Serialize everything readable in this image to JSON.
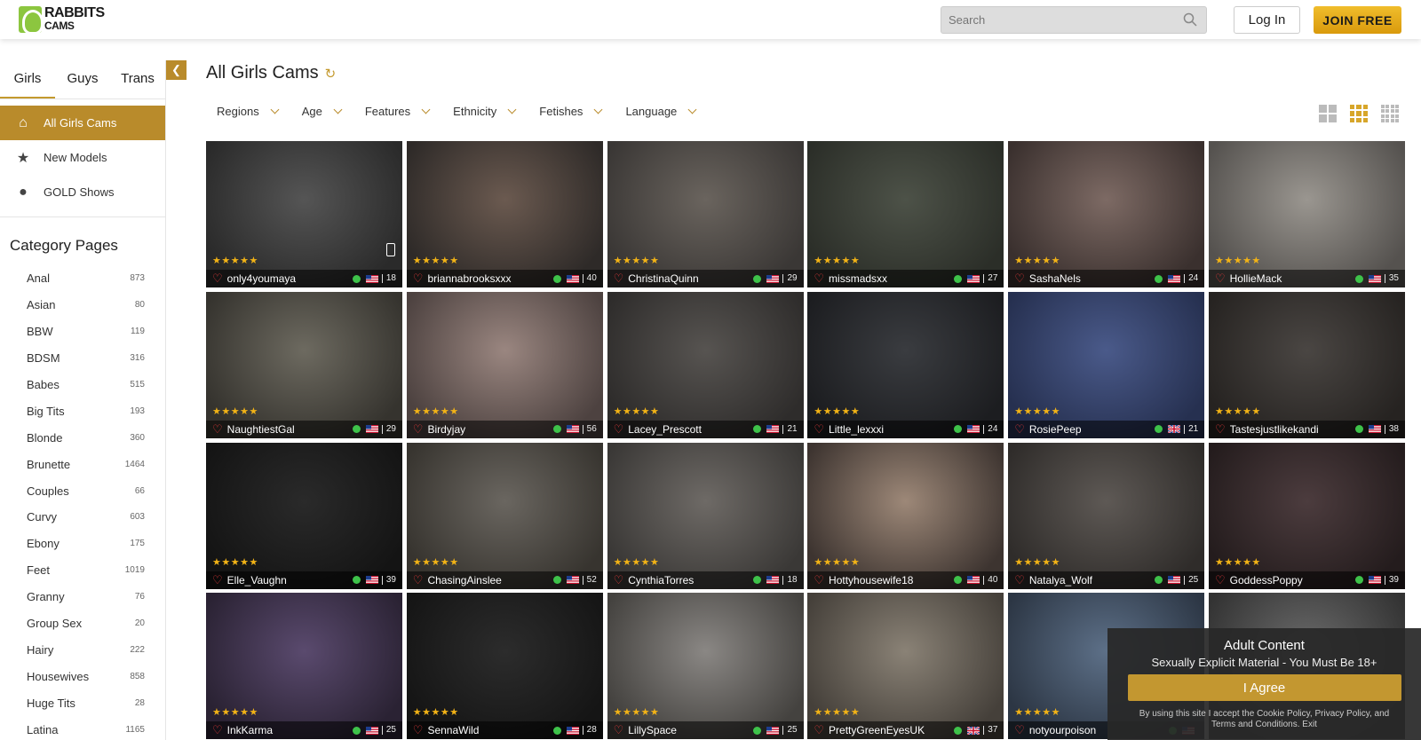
{
  "header": {
    "logo_line1": "RABBITS",
    "logo_line2": "CAMS",
    "search_placeholder": "Search",
    "login_label": "Log In",
    "join_label": "JOIN FREE"
  },
  "sidebar": {
    "tabs": [
      "Girls",
      "Guys",
      "Trans"
    ],
    "nav": [
      {
        "label": "All Girls Cams",
        "icon": "home-icon"
      },
      {
        "label": "New Models",
        "icon": "star-icon"
      },
      {
        "label": "GOLD Shows",
        "icon": "coin-icon"
      }
    ],
    "category_title": "Category Pages",
    "categories": [
      {
        "name": "Anal",
        "count": "873"
      },
      {
        "name": "Asian",
        "count": "80"
      },
      {
        "name": "BBW",
        "count": "119"
      },
      {
        "name": "BDSM",
        "count": "316"
      },
      {
        "name": "Babes",
        "count": "515"
      },
      {
        "name": "Big Tits",
        "count": "193"
      },
      {
        "name": "Blonde",
        "count": "360"
      },
      {
        "name": "Brunette",
        "count": "1464"
      },
      {
        "name": "Couples",
        "count": "66"
      },
      {
        "name": "Curvy",
        "count": "603"
      },
      {
        "name": "Ebony",
        "count": "175"
      },
      {
        "name": "Feet",
        "count": "1019"
      },
      {
        "name": "Granny",
        "count": "76"
      },
      {
        "name": "Group Sex",
        "count": "20"
      },
      {
        "name": "Hairy",
        "count": "222"
      },
      {
        "name": "Housewives",
        "count": "858"
      },
      {
        "name": "Huge Tits",
        "count": "28"
      },
      {
        "name": "Latina",
        "count": "1165"
      }
    ]
  },
  "main": {
    "title": "All Girls Cams",
    "filters": [
      "Regions",
      "Age",
      "Features",
      "Ethnicity",
      "Fetishes",
      "Language"
    ]
  },
  "models": [
    {
      "name": "only4youmaya",
      "flag": "us",
      "age": "18",
      "mobile": true,
      "c1": "#555",
      "c2": "#2a2a2a"
    },
    {
      "name": "briannabrooksxxx",
      "flag": "us",
      "age": "40",
      "c1": "#6b5a50",
      "c2": "#2e2a28"
    },
    {
      "name": "ChristinaQuinn",
      "flag": "us",
      "age": "29",
      "c1": "#6a645e",
      "c2": "#3a3735"
    },
    {
      "name": "missmadsxx",
      "flag": "us",
      "age": "27",
      "c1": "#4d5248",
      "c2": "#2b2e28"
    },
    {
      "name": "SashaNels",
      "flag": "us",
      "age": "24",
      "c1": "#7d6a64",
      "c2": "#3a302e"
    },
    {
      "name": "HollieMack",
      "flag": "us",
      "age": "35",
      "c1": "#9a9690",
      "c2": "#55524f"
    },
    {
      "name": "NaughtiestGal",
      "flag": "us",
      "age": "29",
      "c1": "#6d6a60",
      "c2": "#35332e"
    },
    {
      "name": "Birdyjay",
      "flag": "us",
      "age": "56",
      "c1": "#9a8680",
      "c2": "#4d4240"
    },
    {
      "name": "Lacey_Prescott",
      "flag": "us",
      "age": "21",
      "c1": "#575451",
      "c2": "#2e2c2b"
    },
    {
      "name": "Little_lexxxi",
      "flag": "us",
      "age": "24",
      "c1": "#3a3c40",
      "c2": "#1c1d20"
    },
    {
      "name": "RosiePeep",
      "flag": "uk",
      "age": "21",
      "c1": "#4a5a8a",
      "c2": "#263050"
    },
    {
      "name": "Tastesjustlikekandi",
      "flag": "us",
      "age": "38",
      "c1": "#4a4643",
      "c2": "#262321"
    },
    {
      "name": "Elle_Vaughn",
      "flag": "us",
      "age": "39",
      "c1": "#2a2a2a",
      "c2": "#141414"
    },
    {
      "name": "ChasingAinslee",
      "flag": "us",
      "age": "52",
      "c1": "#6a6660",
      "c2": "#37342f"
    },
    {
      "name": "CynthiaTorres",
      "flag": "us",
      "age": "18",
      "c1": "#6e6a66",
      "c2": "#3a3836"
    },
    {
      "name": "Hottyhousewife18",
      "flag": "us",
      "age": "40",
      "c1": "#9d8878",
      "c2": "#3d3430"
    },
    {
      "name": "Natalya_Wolf",
      "flag": "us",
      "age": "25",
      "c1": "#5e5955",
      "c2": "#2f2c2a"
    },
    {
      "name": "GoddessPoppy",
      "flag": "us",
      "age": "39",
      "c1": "#4c3c3e",
      "c2": "#241c1d"
    },
    {
      "name": "InkKarma",
      "flag": "us",
      "age": "25",
      "c1": "#5a4a6e",
      "c2": "#2a2233"
    },
    {
      "name": "SennaWild",
      "flag": "us",
      "age": "28",
      "c1": "#2c2c2c",
      "c2": "#151515"
    },
    {
      "name": "LillySpace",
      "flag": "us",
      "age": "25",
      "c1": "#8a8784",
      "c2": "#44423f"
    },
    {
      "name": "PrettyGreenEyesUK",
      "flag": "uk",
      "age": "37",
      "c1": "#8a8276",
      "c2": "#45403a"
    },
    {
      "name": "notyourpoison",
      "flag": "us",
      "age": "",
      "c1": "#5d7088",
      "c2": "#2c3644"
    },
    {
      "name": "",
      "flag": "",
      "age": "",
      "c1": "#6b6b6b",
      "c2": "#333"
    }
  ],
  "adult": {
    "title": "Adult Content",
    "subtitle": "Sexually Explicit Material - You Must Be 18+",
    "agree_label": "I Agree",
    "legal": "By using this site I accept the Cookie Policy, Privacy Policy, and Terms and Conditions. Exit"
  },
  "colors": {
    "accent": "#b98b2b",
    "join": "#e3a81a",
    "stars": "#f2b316",
    "online": "#3ec24a"
  }
}
